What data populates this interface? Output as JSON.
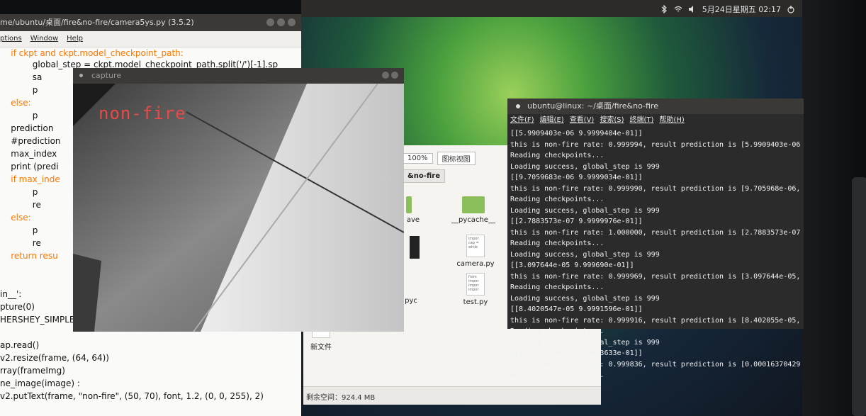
{
  "top_panel": {
    "datetime": "5月24日星期五 02:17",
    "icons": [
      "bluetooth-icon",
      "wifi-icon",
      "power-icon"
    ]
  },
  "editor": {
    "title": "me/ubuntu/桌面/fire&no-fire/camera5ys.py (3.5.2)",
    "menu": [
      "ptions",
      "Window",
      "Help"
    ],
    "code_lines": [
      "    if ckpt and ckpt.model_checkpoint_path:",
      "            global_step = ckpt.model_checkpoint_path.split('/')[-1].sp",
      "            sa",
      "            p",
      "    else:",
      "            p",
      "    prediction",
      "    #prediction",
      "    max_index",
      "    print (predi",
      "    if max_inde",
      "            p",
      "            re",
      "    else:",
      "            p",
      "            re",
      "    return resu",
      "",
      "",
      "in__':",
      "pture(0)",
      "HERSHEY_SIMPLEX",
      "",
      "ap.read()",
      "v2.resize(frame, (64, 64))",
      "rray(frameImg)",
      "ne_image(image) :",
      "v2.putText(frame, \"non-fire\", (50, 70), font, 1.2, (0, 0, 255), 2)"
    ]
  },
  "capture": {
    "title": "capture",
    "overlay": "non-fire"
  },
  "files": {
    "zoom": "100%",
    "view_mode": "图标视图",
    "breadcrumb": "&no-fire",
    "items": [
      {
        "name": "ave",
        "kind": "folder"
      },
      {
        "name": "__pycache__",
        "kind": "folder"
      },
      {
        "name": "",
        "kind": "image"
      },
      {
        "name": "camera.py",
        "kind": "doc",
        "preview": "impor\ncap =\nwhile"
      },
      {
        "name": "pyc",
        "kind": "image"
      },
      {
        "name": "test.py",
        "kind": "doc",
        "preview": "from\nimpor\nimpor\nimpor"
      },
      {
        "name": "新文件",
        "kind": "doc",
        "preview": "sudo"
      }
    ],
    "free_space": "剩余空间：924.4 MB"
  },
  "terminal": {
    "title": "ubuntu@linux: ~/桌面/fire&no-fire",
    "menu": [
      "文件(F)",
      "编辑(E)",
      "查看(V)",
      "搜索(S)",
      "终端(T)",
      "帮助(H)"
    ],
    "lines": [
      "[[5.9909403e-06 9.9999404e-01]]",
      "this is non-fire rate: 0.999994, result prediction is [5.9909403e-06",
      "Reading checkpoints...",
      "Loading success, global_step is 999",
      "[[9.7059683e-06 9.9999034e-01]]",
      "this is non-fire rate: 0.999990, result prediction is [9.705968e-06,",
      "Reading checkpoints...",
      "Loading success, global_step is 999",
      "[[2.7883573e-07 9.9999976e-01]]",
      "this is non-fire rate: 1.000000, result prediction is [2.7883573e-07",
      "Reading checkpoints...",
      "Loading success, global_step is 999",
      "[[3.097644e-05 9.999690e-01]]",
      "this is non-fire rate: 0.999969, result prediction is [3.097644e-05,",
      "Reading checkpoints...",
      "Loading success, global_step is 999",
      "[[8.4020547e-05 9.9991596e-01]]",
      "this is non-fire rate: 0.999916, result prediction is [8.402055e-05,",
      "Reading checkpoints...",
      "Loading success, global_step is 999",
      "[[1.6370429e-04 9.9983633e-01]]",
      "this is non-fire rate: 0.999836, result prediction is [0.00016370429",
      "Reading checkpoints..."
    ]
  },
  "colors": {
    "overlay_text": "#e84a4a",
    "keyword": "#ff7700",
    "terminal_bg": "#2b2b2b",
    "panel_bg": "#2c2b2a"
  }
}
